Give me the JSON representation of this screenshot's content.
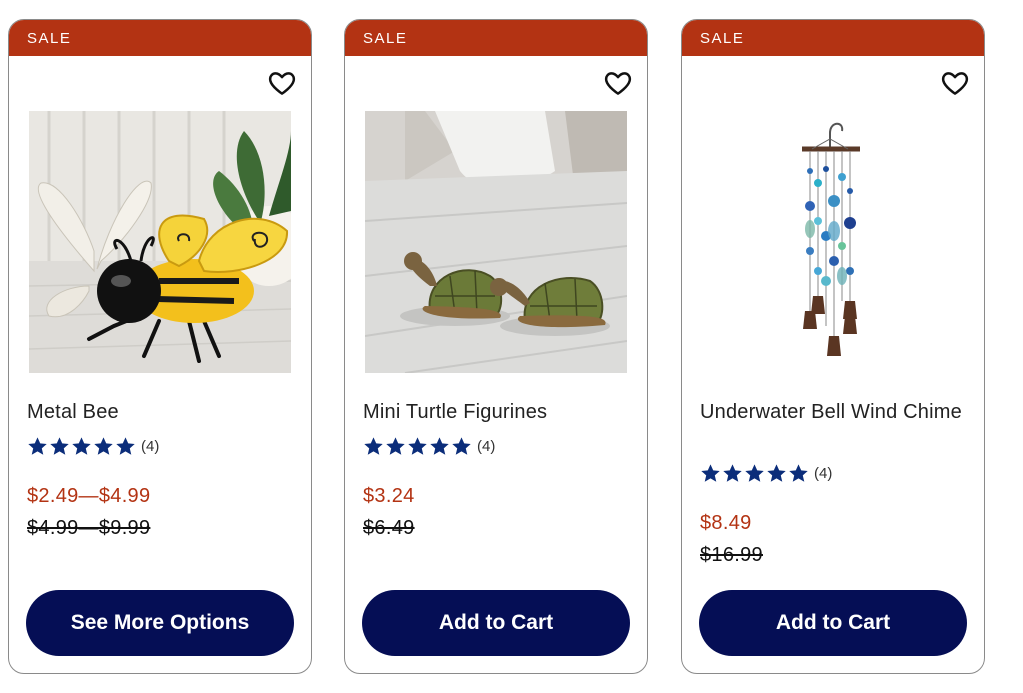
{
  "products": [
    {
      "badge": "SALE",
      "name": "Metal Bee",
      "rating": 5,
      "review_count": "(4)",
      "price": "$2.49—$4.99",
      "original_price": "$4.99—$9.99",
      "button_label": "See More Options",
      "image_icon": "metal-bee-image"
    },
    {
      "badge": "SALE",
      "name": "Mini Turtle Figurines",
      "rating": 5,
      "review_count": "(4)",
      "price": "$3.24",
      "original_price": "$6.49",
      "button_label": "Add to Cart",
      "image_icon": "turtle-figurines-image"
    },
    {
      "badge": "SALE",
      "name": "Underwater Bell Wind Chime",
      "rating": 5,
      "review_count": "(4)",
      "price": "$8.49",
      "original_price": "$16.99",
      "button_label": "Add to Cart",
      "image_icon": "wind-chime-image"
    }
  ],
  "colors": {
    "sale_banner": "#b33313",
    "sale_price": "#b33313",
    "button": "#050e55",
    "stars": "#0b2d7a",
    "card_border": "#8a8a8a"
  }
}
